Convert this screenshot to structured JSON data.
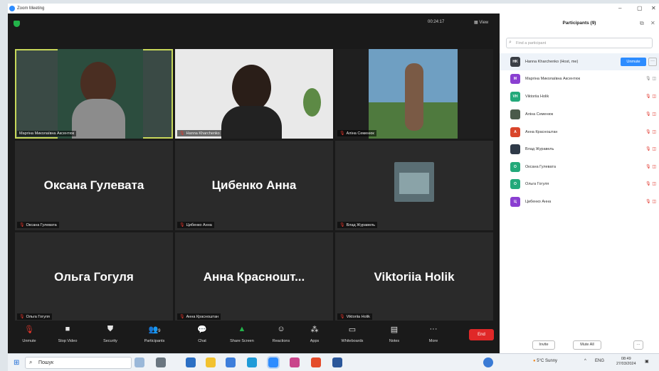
{
  "window": {
    "title": "Zoom Meeting",
    "controls": [
      "–",
      "▢",
      "✕"
    ]
  },
  "topbar": {
    "timer": "00:24:17",
    "view_label": "View"
  },
  "tiles": [
    {
      "label": "Маргіна Миколаївна Аксентюк"
    },
    {
      "label": "Hanna Kharchenko"
    },
    {
      "label": "Аліна Семенюк"
    },
    {
      "center_name": "Оксана Гулевата",
      "label": "Оксана Гулевата"
    },
    {
      "center_name": "Цибенко Анна",
      "label": "Цибенко Анна"
    },
    {
      "label": "Влад Журавель"
    },
    {
      "center_name": "Ольга Гогуля",
      "label": "Ольга Гогуля"
    },
    {
      "center_name": "Анна  Красношт...",
      "label": "Анна Красноштан"
    },
    {
      "center_name": "Viktoriia Holik",
      "label": "Viktoriia Holik"
    }
  ],
  "toolbar": {
    "unmute": "Unmute",
    "stop_video": "Stop Video",
    "security": "Security",
    "participants": "Participants",
    "participants_count": "9",
    "chat": "Chat",
    "share_screen": "Share Screen",
    "reactions": "Reactions",
    "apps": "Apps",
    "whiteboards": "Whiteboards",
    "notes": "Notes",
    "more": "More",
    "end": "End"
  },
  "panel": {
    "title": "Participants (9)",
    "search_placeholder": "Find a participant",
    "unmute_label": "Unmute",
    "invite_label": "Invite",
    "mute_all_label": "Mute All",
    "participants": [
      {
        "initials": "HK",
        "name": "Hanna Kharchenko (Host, me)",
        "color": "#3b3f45"
      },
      {
        "initials": "M",
        "name": "Маргіна Миколаївна Аксентюк",
        "color": "#8a3fd1"
      },
      {
        "initials": "VH",
        "name": "Viktoriia Holik",
        "color": "#23a97a"
      },
      {
        "initials": "",
        "name": "Аліна Семенюк",
        "color": "#4a5a4a"
      },
      {
        "initials": "A",
        "name": "Анна Красноштан",
        "color": "#d9452b"
      },
      {
        "initials": "",
        "name": "Влад Журавель",
        "color": "#2f3a48"
      },
      {
        "initials": "O",
        "name": "Оксана Гулевата",
        "color": "#23a97a"
      },
      {
        "initials": "O",
        "name": "Ольга Гогуля",
        "color": "#23a97a"
      },
      {
        "initials": "Ц",
        "name": "Цибенко Анна",
        "color": "#8a3fd1"
      }
    ]
  },
  "taskbar": {
    "search_text": "Пошук",
    "weather": "5°C  Sunny",
    "lang": "ENG",
    "time": "08:49",
    "date": "27/03/2024"
  }
}
